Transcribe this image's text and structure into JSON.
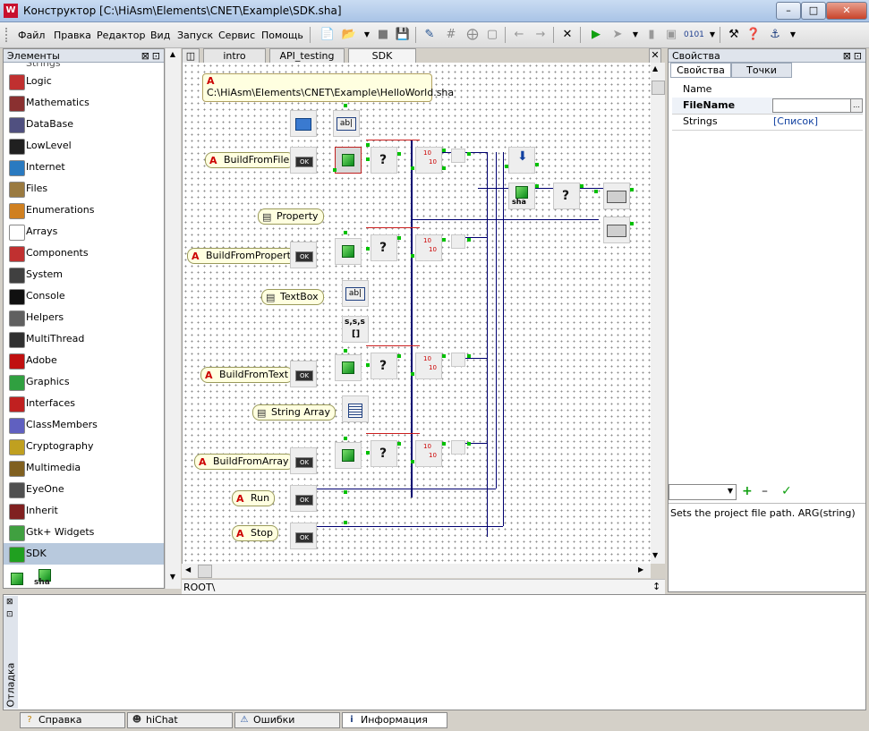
{
  "window": {
    "title": "Конструктор [C:\\HiAsm\\Elements\\CNET\\Example\\SDK.sha]",
    "app_icon": "W"
  },
  "menu": {
    "items": [
      "Файл",
      "Правка",
      "Редактор",
      "Вид",
      "Запуск",
      "Сервис",
      "Помощь"
    ]
  },
  "left_panel": {
    "title": "Элементы",
    "items": [
      {
        "label": "Logic",
        "icon": "logic-icon",
        "color": "#c03030"
      },
      {
        "label": "Mathematics",
        "icon": "calculator-icon",
        "color": "#8a3030"
      },
      {
        "label": "DataBase",
        "icon": "database-icon",
        "color": "#505080"
      },
      {
        "label": "LowLevel",
        "icon": "chip-icon",
        "color": "#202020"
      },
      {
        "label": "Internet",
        "icon": "globe-icon",
        "color": "#2a7ac0"
      },
      {
        "label": "Files",
        "icon": "folder-icon",
        "color": "#9a7a40"
      },
      {
        "label": "Enumerations",
        "icon": "cycle-icon",
        "color": "#d08020"
      },
      {
        "label": "Arrays",
        "icon": "brackets-icon",
        "color": "#ffffff"
      },
      {
        "label": "Components",
        "icon": "puzzle-icon",
        "color": "#c03030"
      },
      {
        "label": "System",
        "icon": "monitor-icon",
        "color": "#404040"
      },
      {
        "label": "Console",
        "icon": "console-icon",
        "color": "#101010"
      },
      {
        "label": "Helpers",
        "icon": "helper-icon",
        "color": "#606060"
      },
      {
        "label": "MultiThread",
        "icon": "thread-icon",
        "color": "#303030"
      },
      {
        "label": "Adobe",
        "icon": "adobe-icon",
        "color": "#c01010"
      },
      {
        "label": "Graphics",
        "icon": "picture-icon",
        "color": "#30a040"
      },
      {
        "label": "Interfaces",
        "icon": "interface-icon",
        "color": "#c02020"
      },
      {
        "label": "ClassMembers",
        "icon": "class-icon",
        "color": "#6060c0"
      },
      {
        "label": "Cryptography",
        "icon": "key-icon",
        "color": "#c0a020"
      },
      {
        "label": "Multimedia",
        "icon": "speaker-icon",
        "color": "#806020"
      },
      {
        "label": "EyeOne",
        "icon": "eye-icon",
        "color": "#505050"
      },
      {
        "label": "Inherit",
        "icon": "tree-icon",
        "color": "#802020"
      },
      {
        "label": "Gtk+ Widgets",
        "icon": "gtk-icon",
        "color": "#40a040"
      },
      {
        "label": "SDK",
        "icon": "cube-icon",
        "color": "#20a020"
      }
    ],
    "sdk_sub": [
      "SDK",
      "sha"
    ]
  },
  "tabs": [
    {
      "label": "intro"
    },
    {
      "label": "API_testing"
    },
    {
      "label": "SDK",
      "active": true
    }
  ],
  "diagram": {
    "path_note": "C:\\HiAsm\\Elements\\CNET\\Example\\HelloWorld.sha",
    "labels": [
      "BuildFromFile",
      "Property",
      "BuildFromProperty",
      "TextBox",
      "BuildFromText",
      "String Array",
      "BuildFromArray",
      "Run",
      "Stop"
    ],
    "array_text": "s,s,s",
    "sha_text": "sha",
    "ok_text": "OK",
    "counter_top": "10",
    "counter_bottom": "10"
  },
  "path_bar": {
    "text": "ROOT\\"
  },
  "right_panel": {
    "title": "Свойства",
    "tabs": [
      "Свойства",
      "Точки"
    ],
    "header": "Name",
    "props": [
      {
        "name": "FileName",
        "value": ""
      },
      {
        "name": "Strings",
        "value": "[Список]"
      }
    ],
    "description": "Sets the project file path. ARG(string)"
  },
  "debug_panel": {
    "title": "Отладка"
  },
  "status_tabs": [
    {
      "label": "Справка",
      "icon": "help-icon"
    },
    {
      "label": "hiChat",
      "icon": "chat-icon"
    },
    {
      "label": "Ошибки",
      "icon": "error-icon"
    },
    {
      "label": "Информация",
      "icon": "info-icon"
    }
  ]
}
